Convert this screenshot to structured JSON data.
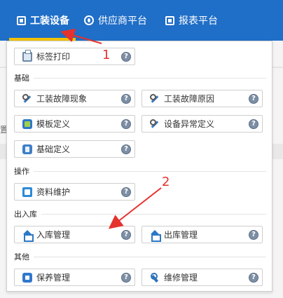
{
  "nav": {
    "items": [
      {
        "label": "工装设备",
        "icon": "tooling-device-icon"
      },
      {
        "label": "供应商平台",
        "icon": "supplier-icon"
      },
      {
        "label": "报表平台",
        "icon": "report-icon"
      }
    ],
    "active_color": "#1f6ec7",
    "indicator_color": "#f2c200"
  },
  "background": {
    "partial_text": "置"
  },
  "menu": {
    "top_items": [
      {
        "label": "标签打印",
        "icon": "print-icon"
      }
    ],
    "sections": [
      {
        "title": "基础",
        "items": [
          {
            "label": "工装故障现象",
            "icon": "tool-icon"
          },
          {
            "label": "工装故障原因",
            "icon": "tool-icon"
          },
          {
            "label": "模板定义",
            "icon": "template-icon"
          },
          {
            "label": "设备异常定义",
            "icon": "tool-icon"
          },
          {
            "label": "基础定义",
            "icon": "basic-definition-icon"
          }
        ]
      },
      {
        "title": "操作",
        "items": [
          {
            "label": "资料维护",
            "icon": "document-icon"
          }
        ]
      },
      {
        "title": "出入库",
        "items": [
          {
            "label": "入库管理",
            "icon": "warehouse-in-icon"
          },
          {
            "label": "出库管理",
            "icon": "warehouse-out-icon"
          }
        ]
      },
      {
        "title": "其他",
        "items": [
          {
            "label": "保养管理",
            "icon": "maintenance-icon"
          },
          {
            "label": "维修管理",
            "icon": "wrench-icon"
          }
        ]
      }
    ],
    "help_glyph": "?"
  },
  "annotations": [
    {
      "label": "1",
      "color": "#e5322d"
    },
    {
      "label": "2",
      "color": "#e5322d"
    }
  ]
}
